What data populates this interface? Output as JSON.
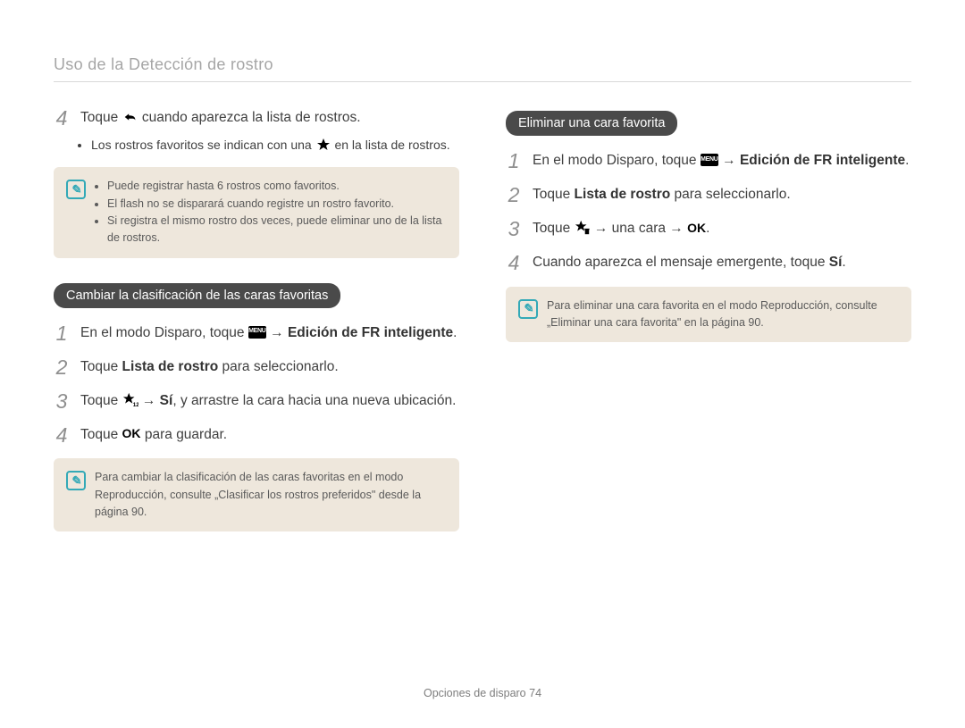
{
  "page_title": "Uso de la Detección de rostro",
  "left": {
    "step4_a": "Toque ",
    "step4_b": " cuando aparezca la lista de rostros.",
    "bullet1_a": "Los rostros favoritos se indican con una ",
    "bullet1_b": " en la lista de rostros.",
    "note1": {
      "items": [
        "Puede registrar hasta 6 rostros como favoritos.",
        "El flash no se disparará cuando registre un rostro favorito.",
        "Si registra el mismo rostro dos veces, puede eliminar uno de la lista de rostros."
      ]
    },
    "pill": "Cambiar la clasificación de las caras favoritas",
    "s1_a": "En el modo Disparo, toque ",
    "s1_b": " → ",
    "s1_c": "Edición de FR inteligente",
    "s1_d": ".",
    "s2_a": "Toque ",
    "s2_b": "Lista de rostro",
    "s2_c": " para seleccionarlo.",
    "s3_a": "Toque ",
    "s3_b": " → ",
    "s3_c": "Sí",
    "s3_d": ", y arrastre la cara hacia una nueva ubicación.",
    "s4_a": "Toque ",
    "s4_b": " para guardar.",
    "note2": "Para cambiar la clasificación de las caras favoritas en el modo Reproducción, consulte „Clasificar los rostros preferidos\" desde la página 90."
  },
  "right": {
    "pill": "Eliminar una cara favorita",
    "s1_a": "En el modo Disparo, toque ",
    "s1_b": " → ",
    "s1_c": "Edición de FR inteligente",
    "s1_d": ".",
    "s2_a": "Toque ",
    "s2_b": "Lista de rostro",
    "s2_c": " para seleccionarlo.",
    "s3_a": "Toque ",
    "s3_b": " → una cara → ",
    "s3_c": ".",
    "s4_a": "Cuando aparezca el mensaje emergente, toque ",
    "s4_b": "Sí",
    "s4_c": ".",
    "note": "Para eliminar una cara favorita en el modo Reproducción, consulte „Eliminar una cara favorita\" en la página 90."
  },
  "footer_label": "Opciones de disparo  74",
  "nums": {
    "n1": "1",
    "n2": "2",
    "n3": "3",
    "n4": "4"
  }
}
